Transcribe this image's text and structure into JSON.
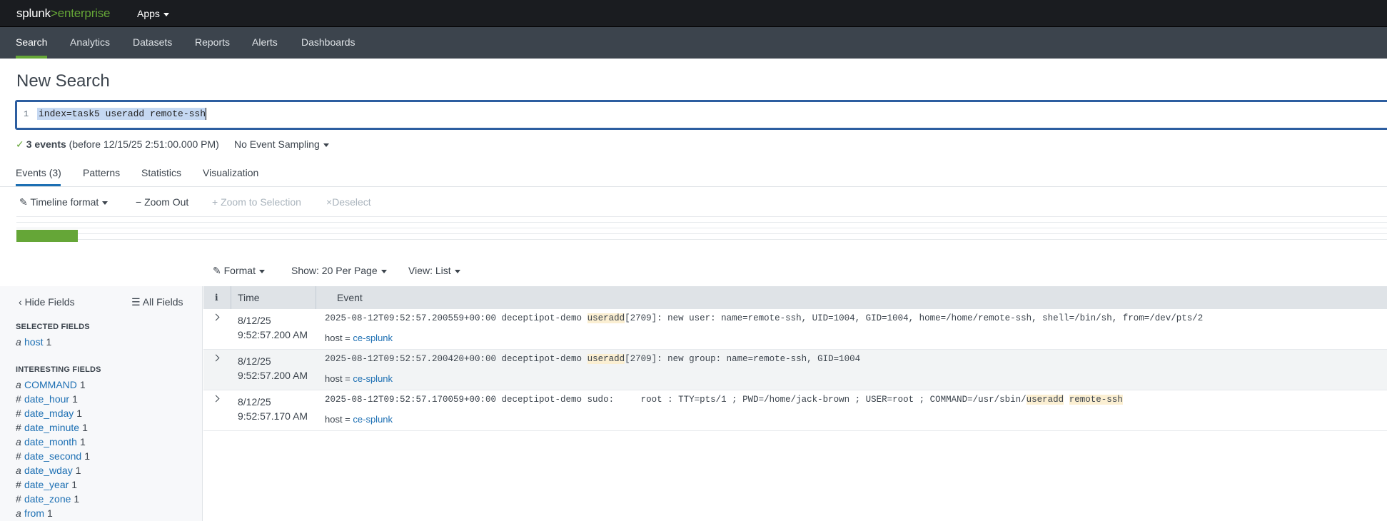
{
  "app": {
    "logo_main": "splunk",
    "logo_sep": ">",
    "logo_sub": "enterprise",
    "apps_label": "Apps"
  },
  "nav": [
    "Search",
    "Analytics",
    "Datasets",
    "Reports",
    "Alerts",
    "Dashboards"
  ],
  "page_title": "New Search",
  "search": {
    "line_number": "1",
    "query": "index=task5 useradd remote-ssh"
  },
  "status": {
    "count": "3 events",
    "detail": "(before 12/15/25 2:51:00.000 PM)",
    "sampling": "No Event Sampling"
  },
  "tabs": [
    "Events (3)",
    "Patterns",
    "Statistics",
    "Visualization"
  ],
  "timeline": {
    "format": "Timeline format",
    "zoom_out": "Zoom Out",
    "zoom_sel": "Zoom to Selection",
    "deselect": "Deselect"
  },
  "results_toolbar": {
    "format": "Format",
    "show": "Show: 20 Per Page",
    "view": "View: List"
  },
  "sidebar": {
    "hide": "Hide Fields",
    "all": "All Fields",
    "selected_title": "SELECTED FIELDS",
    "selected": [
      {
        "type": "a",
        "name": "host",
        "count": "1"
      }
    ],
    "interesting_title": "INTERESTING FIELDS",
    "interesting": [
      {
        "type": "a",
        "name": "COMMAND",
        "count": "1"
      },
      {
        "type": "#",
        "name": "date_hour",
        "count": "1"
      },
      {
        "type": "#",
        "name": "date_mday",
        "count": "1"
      },
      {
        "type": "#",
        "name": "date_minute",
        "count": "1"
      },
      {
        "type": "a",
        "name": "date_month",
        "count": "1"
      },
      {
        "type": "#",
        "name": "date_second",
        "count": "1"
      },
      {
        "type": "a",
        "name": "date_wday",
        "count": "1"
      },
      {
        "type": "#",
        "name": "date_year",
        "count": "1"
      },
      {
        "type": "#",
        "name": "date_zone",
        "count": "1"
      },
      {
        "type": "a",
        "name": "from",
        "count": "1"
      }
    ]
  },
  "grid": {
    "col_i": "i",
    "col_time": "Time",
    "col_event": "Event"
  },
  "events": [
    {
      "date": "8/12/25",
      "time": "9:52:57.200 AM",
      "pre": "2025-08-12T09:52:57.200559+00:00 deceptipot-demo ",
      "hl1": "useradd",
      "post": "[2709]: new user: name=remote-ssh, UID=1004, GID=1004, home=/home/remote-ssh, shell=/bin/sh, from=/dev/pts/2",
      "host_label": "host = ",
      "host": "ce-splunk"
    },
    {
      "date": "8/12/25",
      "time": "9:52:57.200 AM",
      "pre": "2025-08-12T09:52:57.200420+00:00 deceptipot-demo ",
      "hl1": "useradd",
      "post": "[2709]: new group: name=remote-ssh, GID=1004",
      "host_label": "host = ",
      "host": "ce-splunk"
    },
    {
      "date": "8/12/25",
      "time": "9:52:57.170 AM",
      "pre": "2025-08-12T09:52:57.170059+00:00 deceptipot-demo sudo:     root : TTY=pts/1 ; PWD=/home/jack-brown ; USER=root ; COMMAND=/usr/sbin/",
      "hl1": "useradd",
      "mid": " ",
      "hl2": "remote-ssh",
      "host_label": "host = ",
      "host": "ce-splunk"
    }
  ]
}
